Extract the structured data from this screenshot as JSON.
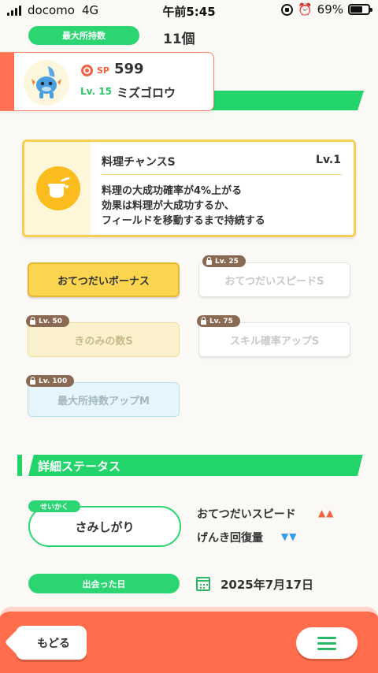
{
  "status_bar": {
    "carrier": "docomo",
    "network": "4G",
    "time": "午前5:45",
    "battery": "69%",
    "battery_level": 0.69
  },
  "inventory": {
    "label": "最大所持数",
    "value": "11個"
  },
  "pokemon": {
    "sp_label": "SP",
    "sp_value": "599",
    "level_label": "Lv. 15",
    "name": "ミズゴロウ"
  },
  "main_skill": {
    "name": "料理チャンスS",
    "level": "Lv.1",
    "description": [
      "料理の大成功確率が4%上がる",
      "効果は料理が大成功するか、",
      "フィールドを移動するまで持続する"
    ]
  },
  "sub_skills": [
    {
      "label": "おてつだいボーナス",
      "unlock": "",
      "state": "active"
    },
    {
      "label": "おてつだいスピードS",
      "unlock": "Lv. 25",
      "state": "locked"
    },
    {
      "label": "きのみの数S",
      "unlock": "Lv. 50",
      "state": "locked"
    },
    {
      "label": "スキル確率アップS",
      "unlock": "Lv. 75",
      "state": "locked"
    },
    {
      "label": "最大所持数アップM",
      "unlock": "Lv. 100",
      "state": "locked"
    }
  ],
  "details": {
    "header": "詳細ステータス",
    "nature_tag": "せいかく",
    "nature": "さみしがり",
    "up_stat": "おてつだいスピード",
    "up_marks": "▲▲",
    "down_stat": "げんき回復量",
    "down_marks": "▼▼",
    "met_label": "出会った日",
    "met_date": "2025年7月17日"
  },
  "bottom_bar": {
    "back_label": "もどる"
  },
  "colors": {
    "green": "#2bd672",
    "orange": "#ff6d4c",
    "yellow": "#fbd54f",
    "up_red": "#f26243",
    "down_blue": "#2f9be6"
  }
}
